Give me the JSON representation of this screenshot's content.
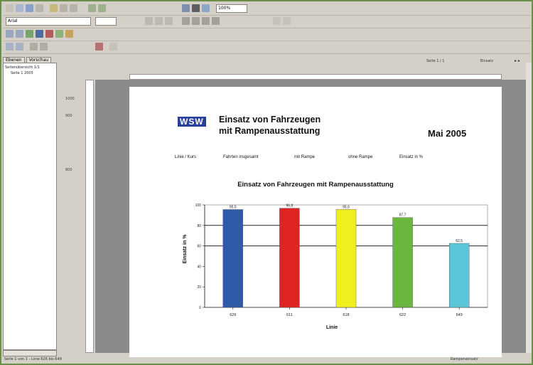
{
  "toolbar": {
    "font_size": "Arial",
    "zoom": "100%"
  },
  "sidebar": {
    "tabs": [
      "Ebenen",
      "Vorschau"
    ],
    "tree": [
      "Seitenübersicht 1/1",
      "Seite 1 2005"
    ]
  },
  "header_right": {
    "label_a": "Seite 1 / 1",
    "label_b": "Einsatz"
  },
  "document": {
    "logo": "WSW",
    "title_line1": "Einsatz von Fahrzeugen",
    "title_line2": "mit Rampenausstattung",
    "date": "Mai 2005",
    "columns": [
      "Linie / Kurs",
      "Fahrten insgesamt",
      "mit Rampe",
      "ohne Rampe",
      "Einsatz in %"
    ],
    "margin_labels": [
      "1000",
      "900",
      "800"
    ]
  },
  "chart_data": {
    "type": "bar",
    "title": "Einsatz von Fahrzeugen mit Rampenausstattung",
    "xlabel": "Linie",
    "ylabel": "Einsatz in %",
    "categories": [
      "626",
      "611",
      "618",
      "622",
      "649"
    ],
    "values": [
      95.5,
      96.8,
      95.6,
      87.7,
      62.5
    ],
    "value_labels": [
      "95,5",
      "96,8",
      "95,6",
      "87,7",
      "62,5"
    ],
    "colors": [
      "#2f5aa8",
      "#e02424",
      "#f0ee1f",
      "#6bb63f",
      "#5cc6d9"
    ],
    "ylim": [
      0,
      100
    ],
    "y_ticks": [
      "0",
      "20",
      "40",
      "60",
      "80",
      "100"
    ],
    "reference_lines": [
      80,
      60
    ],
    "grid": false
  },
  "status": {
    "left": "Seite 1 von 1 - Linie 626 bis 649",
    "right": "Rampeneinsatz"
  }
}
